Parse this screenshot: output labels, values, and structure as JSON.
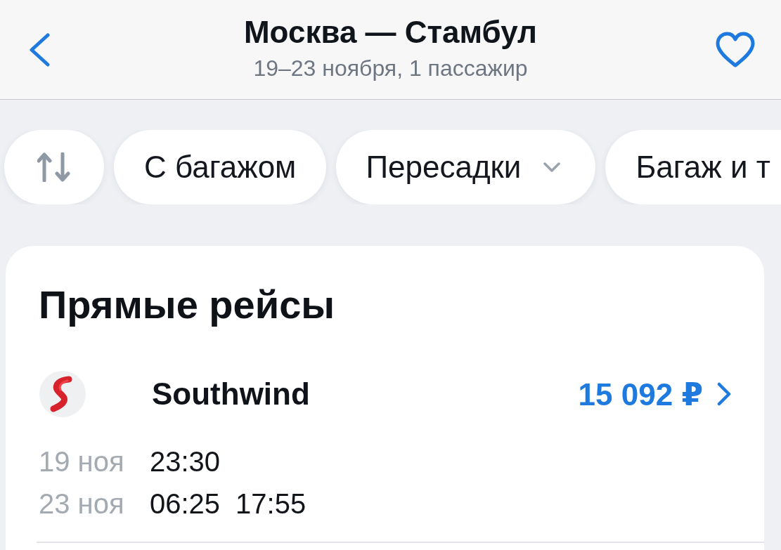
{
  "header": {
    "title": "Москва — Стамбул",
    "subtitle": "19–23 ноября, 1 пассажир"
  },
  "filters": [
    {
      "kind": "sort"
    },
    {
      "kind": "chip",
      "label": "С багажом"
    },
    {
      "kind": "dropdown",
      "label": "Пересадки"
    },
    {
      "kind": "chip",
      "label": "Багаж и т"
    }
  ],
  "section": {
    "title": "Прямые рейсы",
    "flights": [
      {
        "airline": "Southwind",
        "price": "15 092 ₽",
        "legs": [
          {
            "date": "19 ноя",
            "times": [
              "23:30"
            ]
          },
          {
            "date": "23 ноя",
            "times": [
              "06:25",
              "17:55"
            ]
          }
        ]
      }
    ]
  }
}
